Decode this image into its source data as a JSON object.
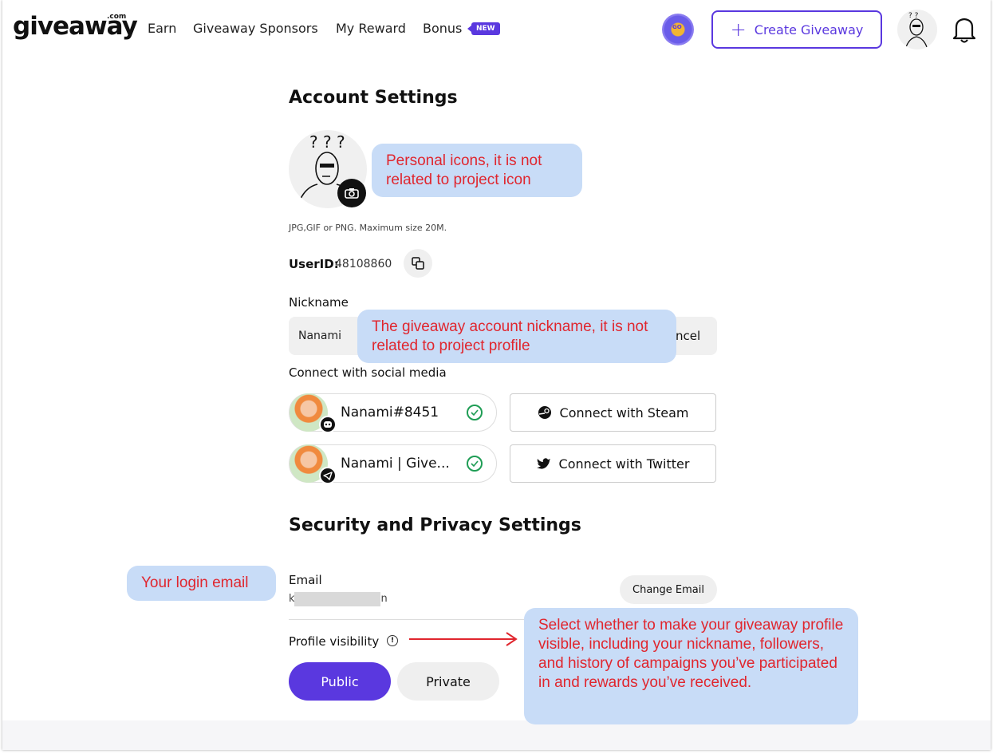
{
  "header": {
    "logo": "giveaway",
    "logo_suffix": ".com",
    "nav": [
      {
        "label": "Earn"
      },
      {
        "label": "Giveaway Sponsors"
      },
      {
        "label": "My Reward"
      },
      {
        "label": "Bonus"
      }
    ],
    "bonus_badge": "NEW",
    "coin_label": "GO",
    "create_button": "Create Giveaway",
    "accent_color": "#5a38df"
  },
  "account": {
    "title": "Account Settings",
    "avatar_hint": "JPG,GIF or PNG. Maximum size 20M.",
    "userid_label": "UserID:",
    "userid_value": "48108860",
    "nickname_label": "Nickname",
    "nickname_value": "Nanami",
    "cancel_label": "ncel",
    "social_label": "Connect with social media",
    "social": [
      {
        "name": "Nanami#8451",
        "platform_icon": "discord-icon",
        "connected": true
      },
      {
        "name": "Nanami | Give...",
        "platform_icon": "telegram-icon",
        "connected": true
      }
    ],
    "connect_buttons": [
      {
        "label": "Connect with Steam",
        "icon": "steam-icon"
      },
      {
        "label": "Connect with Twitter",
        "icon": "twitter-icon"
      }
    ]
  },
  "security": {
    "title": "Security and Privacy Settings",
    "email_label": "Email",
    "email_value_start": "k",
    "email_value_end": "n",
    "change_email": "Change Email",
    "visibility_label": "Profile visibility",
    "visibility_options": [
      "Public",
      "Private"
    ],
    "visibility_selected": "Public"
  },
  "annotations": {
    "avatar_note": "Personal icons, it is not related to project icon",
    "nickname_note": "The giveaway account nickname, it is not related to project profile",
    "email_note": "Your login email",
    "visibility_note": "Select whether to make your giveaway profile visible, including your nickname, followers, and history of campaigns you’ve participated in and rewards you’ve received.",
    "note_bg": "#c8dcf7",
    "note_text_color": "#e0262e"
  }
}
